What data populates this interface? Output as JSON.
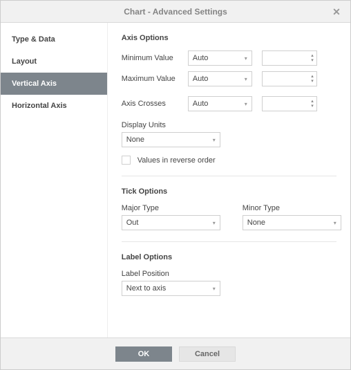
{
  "title": "Chart - Advanced Settings",
  "sidebar": {
    "items": [
      {
        "label": "Type & Data",
        "active": false
      },
      {
        "label": "Layout",
        "active": false
      },
      {
        "label": "Vertical Axis",
        "active": true
      },
      {
        "label": "Horizontal Axis",
        "active": false
      }
    ]
  },
  "axis_options": {
    "heading": "Axis Options",
    "min_label": "Minimum Value",
    "min_mode": "Auto",
    "min_value": "",
    "max_label": "Maximum Value",
    "max_mode": "Auto",
    "max_value": "",
    "crosses_label": "Axis Crosses",
    "crosses_mode": "Auto",
    "crosses_value": "",
    "display_units_label": "Display Units",
    "display_units_value": "None",
    "reverse_label": "Values in reverse order",
    "reverse_checked": false
  },
  "tick_options": {
    "heading": "Tick Options",
    "major_label": "Major Type",
    "major_value": "Out",
    "minor_label": "Minor Type",
    "minor_value": "None"
  },
  "label_options": {
    "heading": "Label Options",
    "position_label": "Label Position",
    "position_value": "Next to axis"
  },
  "footer": {
    "ok": "OK",
    "cancel": "Cancel"
  }
}
